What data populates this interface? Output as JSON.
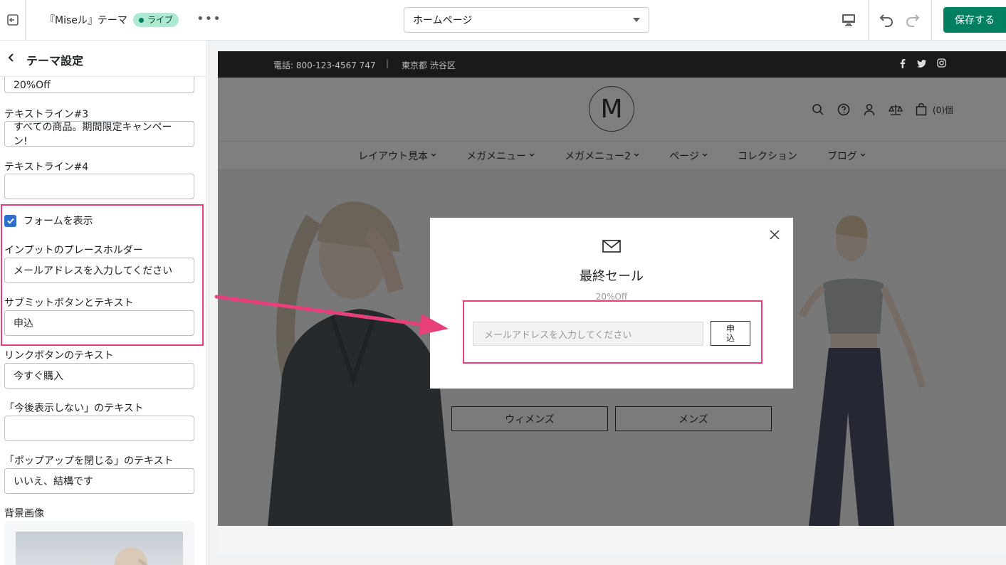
{
  "topbar": {
    "theme_title": "『Miseル』テーマ",
    "live_badge": "ライブ",
    "more": "•••",
    "page_select": "ホームページ",
    "save_label": "保存する"
  },
  "sidebar": {
    "title": "テーマ設定",
    "partial_value": "20%Off",
    "text3_label": "テキストライン#3",
    "text3_value": "すべての商品。期間限定キャンペーン!",
    "text4_label": "テキストライン#4",
    "text4_value": "",
    "show_form_label": "フォームを表示",
    "show_form_checked": true,
    "placeholder_label": "インプットのプレースホルダー",
    "placeholder_value": "メールアドレスを入力してください",
    "submit_label": "サブミットボタンとテキスト",
    "submit_value": "申込",
    "link_label": "リンクボタンのテキスト",
    "link_value": "今すぐ購入",
    "dont_show_label": "「今後表示しない」のテキスト",
    "dont_show_value": "",
    "close_label": "「ポップアップを閉じる」のテキスト",
    "close_value": "いいえ、結構です",
    "bg_image_label": "背景画像"
  },
  "preview": {
    "announcement": {
      "phone": "電話: 800-123-4567 747",
      "separator": "|",
      "address": "東京都 渋谷区"
    },
    "logo_letter": "M",
    "cart_count": "(0)個",
    "nav": [
      "レイアウト見本",
      "メガメニュー",
      "メガメニュー2",
      "ページ",
      "コレクション",
      "ブログ"
    ],
    "nav_has_dropdown": [
      true,
      true,
      true,
      true,
      false,
      true
    ],
    "hero_buttons": [
      "ウィメンズ",
      "メンズ"
    ]
  },
  "modal": {
    "title": "最終セール",
    "subtitle": "20%Off",
    "input_placeholder": "メールアドレスを入力してください",
    "submit": "申込"
  },
  "colors": {
    "primary": "#008060",
    "highlight": "#e8407b",
    "checkbox": "#2c6ecb",
    "live_badge_bg": "#aee9d1"
  }
}
